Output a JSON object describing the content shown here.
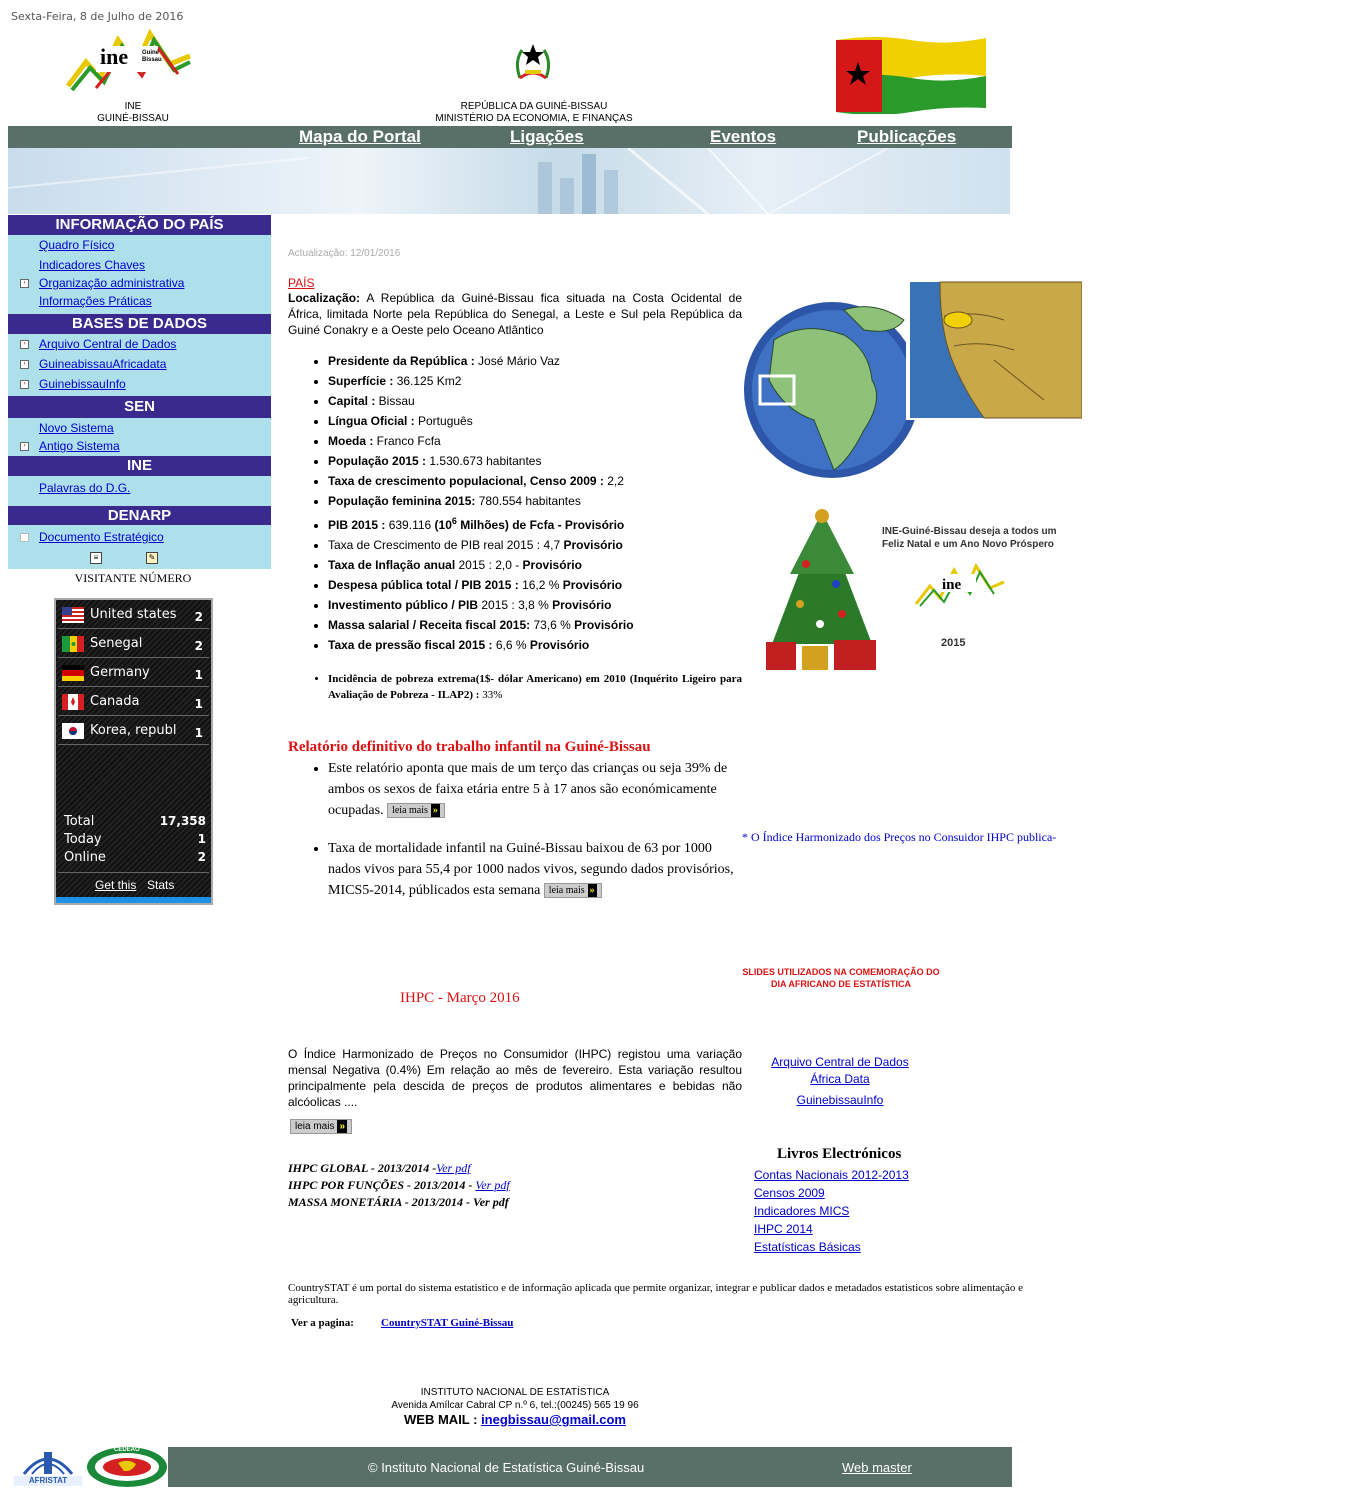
{
  "date": "Sexta-Feira, 8 de Julho de 2016",
  "header": {
    "ine_logo_text": "ine",
    "ine_logo_sub": "Guiné Bissau",
    "left_line1": "INE",
    "left_line2": "GUINÉ-BISSAU",
    "center_line1": "REPÚBLICA DA GUINÉ-BISSAU",
    "center_line2": "MINISTÉRIO DA ECONOMIA, E FINANÇAS"
  },
  "nav": {
    "items": [
      "Mapa do Portal",
      "Ligações",
      "Eventos",
      "Publicações"
    ]
  },
  "sidebar": {
    "sections": [
      {
        "title": "INFORMAÇÃO DO PAÍS",
        "items": [
          "Quadro Físico",
          "Indicadores Chaves",
          "Organização administrativa",
          "Informações Práticas"
        ]
      },
      {
        "title": "BASES DE DADOS",
        "items": [
          "Arquivo Central de Dados",
          "GuineabissauAfricadata",
          "GuinebissauInfo"
        ]
      },
      {
        "title": "SEN",
        "items": [
          "Novo Sistema",
          "Antigo Sistema"
        ]
      },
      {
        "title": "INE",
        "items": [
          "Palavras do D.G."
        ]
      },
      {
        "title": "DENARP",
        "items": [
          "Documento Estratégico"
        ]
      }
    ],
    "visitor_label": "VISITANTE NÚMERO"
  },
  "stats_widget": {
    "countries": [
      {
        "name": "United states",
        "count": "2",
        "flag": "us-flag-icon"
      },
      {
        "name": "Senegal",
        "count": "2",
        "flag": "senegal-flag-icon"
      },
      {
        "name": "Germany",
        "count": "1",
        "flag": "germany-flag-icon"
      },
      {
        "name": "Canada",
        "count": "1",
        "flag": "canada-flag-icon"
      },
      {
        "name": "Korea, republ",
        "count": "1",
        "flag": "korea-flag-icon"
      }
    ],
    "total_label": "Total",
    "total": "17,358",
    "today_label": "Today",
    "today": "1",
    "online_label": "Online",
    "online": "2",
    "get_this": "Get this",
    "stats": "Stats"
  },
  "main": {
    "update": "Actualização: 12/01/2016",
    "pais": "PAÍS",
    "loc_label": "Localização:",
    "loc_text": " A República da Guiné-Bissau fica situada na Costa Ocidental de África, limitada Norte pela República do Senegal, a Leste e Sul pela República da Guiné Conakry e a Oeste pelo Oceano Atlântico",
    "facts": [
      {
        "label": "Presidente da República :",
        "value": " José Mário Vaz"
      },
      {
        "label": "Superfície :",
        "value": " 36.125 Km2"
      },
      {
        "label": "Capital :",
        "value": " Bissau"
      },
      {
        "label": "Língua Oficial :",
        "value": " Português"
      },
      {
        "label": "Moeda :",
        "value": " Franco Fcfa"
      },
      {
        "label": "População 2015 :",
        "value": " 1.530.673 habitantes"
      },
      {
        "label": "Taxa de crescimento populacional, Censo 2009 :",
        "value": " 2,2"
      },
      {
        "label": "População feminina 2015:",
        "value": " 780.554 habitantes"
      },
      {
        "label": "PIB 2015 :",
        "value": " 639.116 "
      },
      {
        "label": "Taxa de Crescimento de PIB real",
        "value": "  2015 : 4,7 "
      },
      {
        "label": "Taxa de Inflação anual",
        "value": " 2015 : 2,0  - "
      },
      {
        "label": "Despesa pública total / PIB 2015 :",
        "value": " 16,2 % "
      },
      {
        "label": "Investimento público / PIB",
        "value": "  2015 : 3,8 % "
      },
      {
        "label": "Massa salarial / Receita fiscal 2015:",
        "value": " 73,6 % "
      },
      {
        "label": "Taxa de pressão fiscal 2015 :",
        "value": " 6,6 % "
      }
    ],
    "pib_suffix_bold1": "(10",
    "pib_sup": "6",
    "pib_suffix_bold2": " Milhões) de Fcfa - Provisório",
    "provisorio": "Provisório",
    "pobreza_label": "Incidência de pobreza  extrema(1$- dólar Americano) em 2010 (Inquérito Ligeiro para Avaliação de Pobreza - ILAP2) :",
    "pobreza_value": " 33%",
    "relatorio_title": "Relatório definitivo do trabalho infantil na Guiné-Bissau",
    "relatorio_items": [
      "Este relatório aponta que mais de um terço  das  crianças ou seja 39%  de ambos os sexos de faixa etária entre 5 à 17 anos são económicamente ocupadas.",
      "Taxa de mortalidade infantil na Guiné-Bissau baixou de 63 por 1000 nados vivos para 55,4 por 1000 nados vivos, segundo dados provisórios, MICS5-2014, públicados esta semana"
    ],
    "leia_mais": "leia mais",
    "ihpc_title": "IHPC - Março 2016",
    "ihpc_text": "O Índice Harmonizado de Preços no Consumidor (IHPC) registou uma variação mensal Negativa (0.4%) Em relação ao mês de fevereiro. Esta variação resultou principalmente pela descida de preços de produtos alimentares e bebidas não alcóolicas ....",
    "pdf_lines": [
      {
        "text": "IHPC  GLOBAL - 2013/2014  -",
        "link": "Ver pdf "
      },
      {
        "text": "IHPC POR FUNÇÕES - 2013/2014 - ",
        "link": "Ver pdf"
      },
      {
        "text": "MASSA MONETÁRIA - 2013/2014 - Ver pdf",
        "link": ""
      }
    ],
    "countrystat_text": "CountrySTAT é um portal do sistema estatistico e de informação aplicada que permite organizar, integrar e publicar dados e metadados estatisticos sobre  alimentação e agricultura.",
    "ver_pagina": "Ver a pagina:",
    "countrystat_link": "CountrySTAT Guiné-Bissau"
  },
  "right": {
    "greeting_line1": "INE-Guiné-Bissau deseja a todos um",
    "greeting_line2": "Feliz Natal e um Ano Novo Próspero",
    "greeting_year": "2015",
    "ticker": "* O Índice Harmonizado dos Preços no Consuidor IHPC publica-",
    "slides": "SLIDES UTILIZADOS NA COMEMORAÇÃO DO DIA AFRICANO DE ESTATÍSTICA",
    "link1": "Arquivo Central de Dados",
    "link2": "África Data ",
    "link3": "GuinebissauInfo ",
    "livros_title": "Livros Electrónicos",
    "livros": [
      "Contas Nacionais 2012-2013",
      "Censos 2009",
      "Indicadores MICS",
      "IHPC 2014",
      "Estatísticas Básicas"
    ]
  },
  "contact": {
    "line1": "INSTITUTO NACIONAL DE ESTATÍSTICA",
    "line2": "Avenida Amílcar Cabral CP n.º 6, tel.:(00245) 565 19 96",
    "mail_label": "WEB MAIL : ",
    "mail": "inegbissau@gmail.com"
  },
  "footer": {
    "afristat": "AFRISTAT",
    "cedeao": "CEDEAO",
    "copyright": "© Instituto Nacional de Estatística Guiné-Bissau",
    "webmaster": "Web master"
  },
  "colors": {
    "nav_bg": "#587068",
    "sidebar_head": "#3a2a8e",
    "sidebar_bg": "#aee0ec",
    "link": "#0000cc",
    "red": "#dd1111"
  }
}
